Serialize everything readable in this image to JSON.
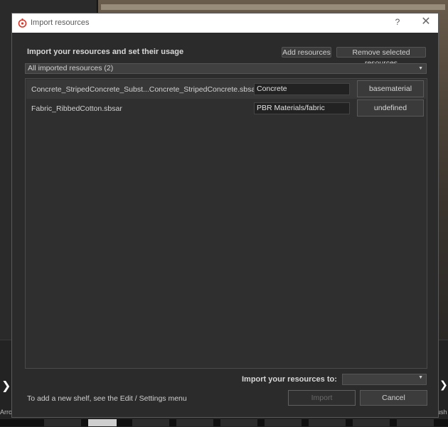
{
  "dialog": {
    "title": "Import resources",
    "help_glyph": "?",
    "close_glyph": "✕",
    "header_label": "Import your resources and set their usage",
    "add_resources": "Add resources",
    "remove_selected": "Remove selected resources",
    "filter_value": "All imported resources (2)",
    "resources": [
      {
        "name": "Concrete_StripedConcrete_Subst...Concrete_StripedConcrete.sbsar",
        "usage": "Concrete",
        "type": "basematerial"
      },
      {
        "name": "Fabric_RibbedCotton.sbsar",
        "usage": "PBR Materials/fabric",
        "type": "undefined"
      }
    ],
    "import_to_label": "Import your resources to:",
    "import_to_value": "",
    "hint": "To add a new shelf, see the Edit / Settings menu",
    "import_button": "Import",
    "cancel_button": "Cancel"
  },
  "background": {
    "shelf_left_label": "Arro",
    "shelf_right_label": "ush"
  },
  "icons": {
    "app_icon": "substance-painter-icon",
    "caret": "chevron-down-icon",
    "arrow": "chevron-right-icon"
  },
  "colors": {
    "dialog_bg": "#2b2b2b",
    "titlebar_bg": "#ffffff",
    "list_bg": "#2f2f2f",
    "app_icon": "#d9372a"
  }
}
